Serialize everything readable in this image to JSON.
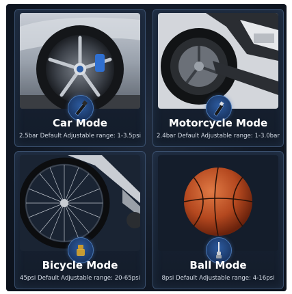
{
  "cards": [
    {
      "title": "Car Mode",
      "subtitle": "2.5bar Default Adjustable range: 1-3.5psi",
      "icon": "hose-connector-icon"
    },
    {
      "title": "Motorcycle Mode",
      "subtitle": "2.4bar Default Adjustable range: 1-3.0bar",
      "icon": "valve-adapter-icon"
    },
    {
      "title": "Bicycle Mode",
      "subtitle": "45psi Default Adjustable range: 20-65psi",
      "icon": "presta-adapter-icon"
    },
    {
      "title": "Ball Mode",
      "subtitle": "8psi Default Adjustable range: 4-16psi",
      "icon": "ball-needle-icon"
    }
  ],
  "colors": {
    "background": "#121a27",
    "card_border": "#3a4f6d",
    "badge": "#1b3867"
  }
}
